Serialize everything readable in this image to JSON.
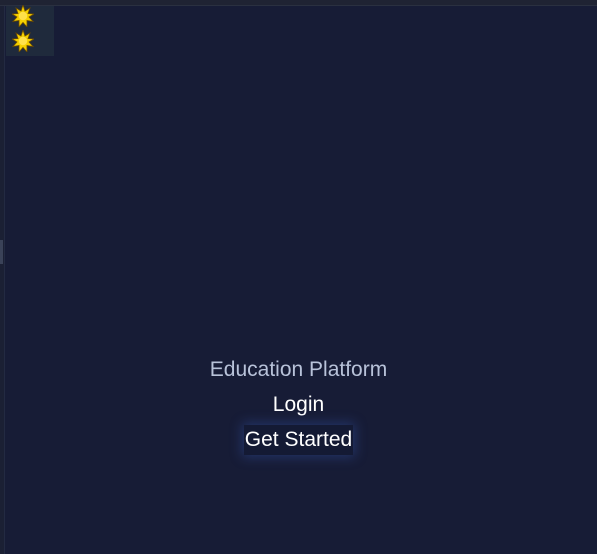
{
  "theme_controls": {
    "icons": [
      "sun-icon",
      "sun-icon"
    ],
    "icon_color": "#f5d000",
    "icon_outline": "#6b4a00"
  },
  "main": {
    "title": "Education Platform",
    "login_label": "Login",
    "get_started_label": "Get Started"
  },
  "colors": {
    "background": "#171c36",
    "title_text": "#b8c2d9",
    "button_text": "#ffffff",
    "panel": "#1f2a3c"
  }
}
